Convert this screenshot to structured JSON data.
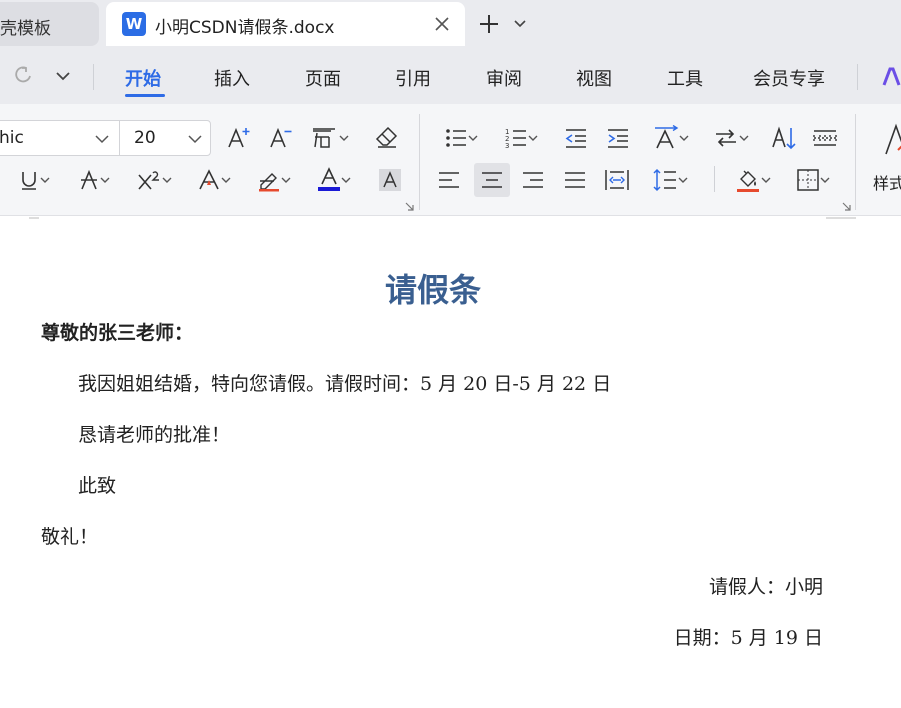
{
  "tabs": {
    "previous_tab_label": "壳模板",
    "active_tab_label": "小明CSDN请假条.docx",
    "active_tab_app_icon": "wps-writer-icon",
    "app_icon_letter": "W"
  },
  "menu": {
    "items": [
      "开始",
      "插入",
      "页面",
      "引用",
      "审阅",
      "视图",
      "工具",
      "会员专享"
    ],
    "active": "开始"
  },
  "ribbon": {
    "font_name": "hic",
    "font_size": "20",
    "style_label": "样式"
  },
  "document": {
    "title": "请假条",
    "salutation": "尊敬的张三老师：",
    "body_line_1": "我因姐姐结婚，特向您请假。请假时间：5 月 20 日-5 月 22 日",
    "body_line_2": "恳请老师的批准！",
    "closing_1": "此致",
    "closing_2": "敬礼！",
    "signature": "请假人：小明",
    "date": "日期：5 月 19 日"
  },
  "colors": {
    "accent": "#2e6be6",
    "title_color": "#3a5f90",
    "font_color_bar": "#1a1ad6"
  }
}
